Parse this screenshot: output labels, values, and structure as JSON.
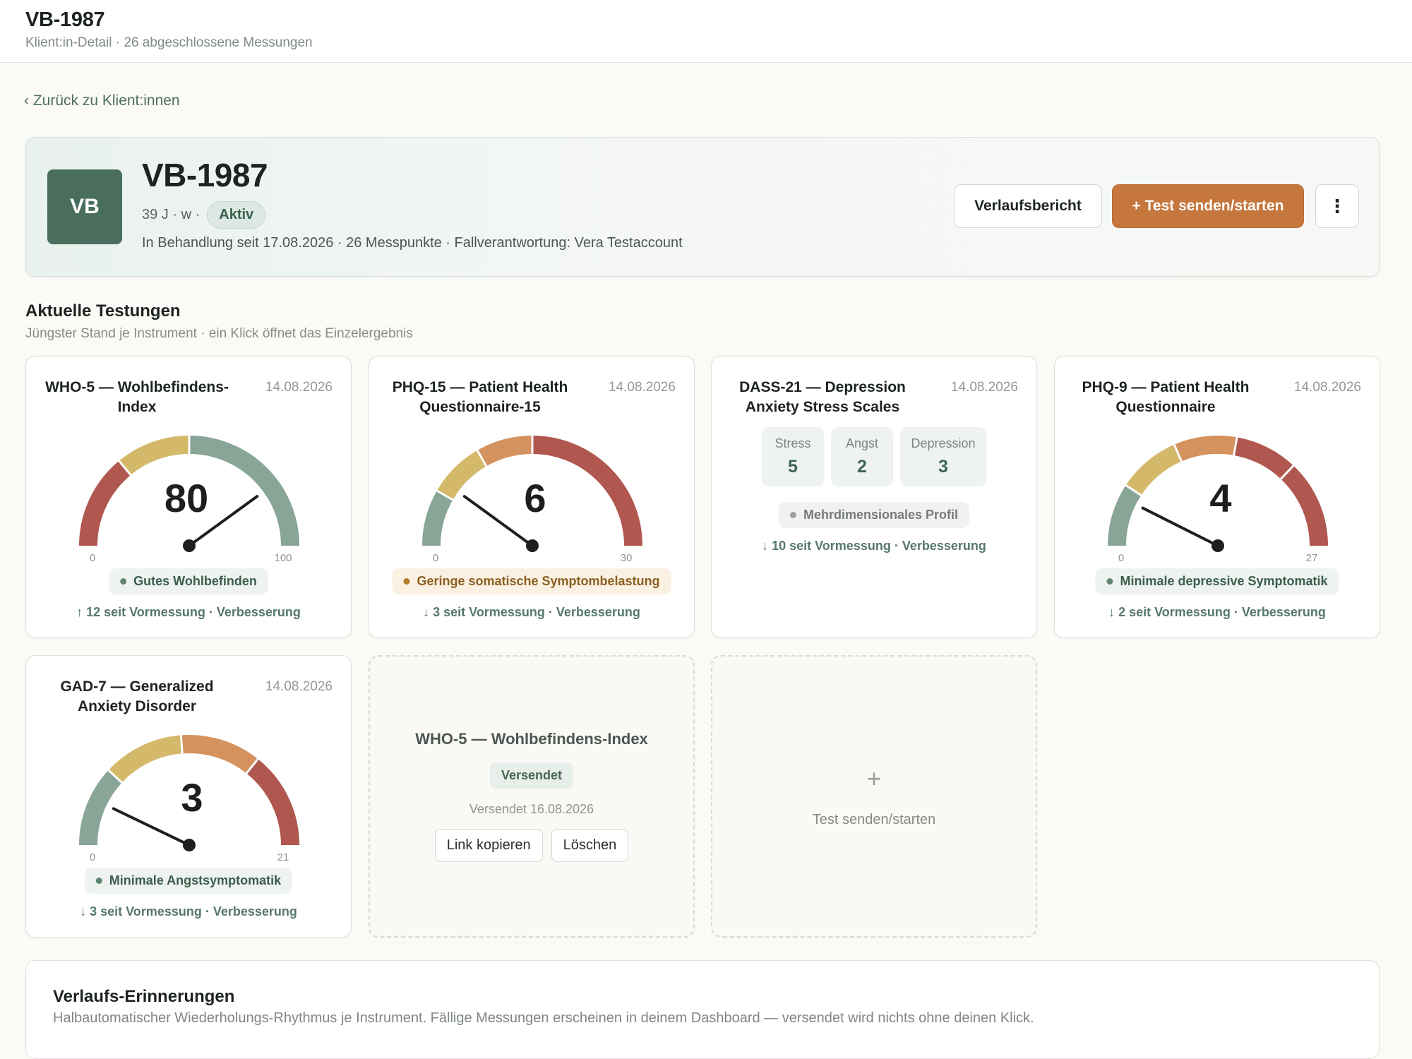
{
  "header": {
    "title": "VB-1987",
    "subtitle": "Klient:in-Detail · 26 abgeschlossene Messungen"
  },
  "back_link": "‹ Zurück zu Klient:innen",
  "client": {
    "initials": "VB",
    "name": "VB-1987",
    "meta": "39 J · w ·",
    "status": "Aktiv",
    "info": "In Behandlung seit 17.08.2026 · 26 Messpunkte · Fallverantwortung: Vera Testaccount"
  },
  "actions": {
    "report": "Verlaufsbericht",
    "send_test": "+ Test senden/starten",
    "more_icon": "more-vertical-icon",
    "more_glyph": "⋮"
  },
  "section": {
    "title": "Aktuelle Testungen",
    "subtitle": "Jüngster Stand je Instrument · ein Klick öffnet das Einzelergebnis"
  },
  "gauge_colors": {
    "green": "#88a597",
    "yellow": "#d4b96a",
    "orange": "#d4925e",
    "red": "#b0574f",
    "needle": "#1c1f1e"
  },
  "cards": [
    {
      "title": "WHO-5 — Wohlbefindens-Index",
      "date": "14.08.2026",
      "score": "80",
      "min": "0",
      "max": "100",
      "value": 80,
      "range_max": 100,
      "segments": [
        {
          "from": 0,
          "to": 28,
          "color": "red"
        },
        {
          "from": 28,
          "to": 50,
          "color": "yellow"
        },
        {
          "from": 50,
          "to": 100,
          "color": "green"
        }
      ],
      "status": "Gutes Wohlbefinden",
      "status_tone": "green",
      "delta": "↑ 12 seit Vormessung · Verbesserung"
    },
    {
      "title": "PHQ-15 — Patient Health Questionnaire-15",
      "date": "14.08.2026",
      "score": "6",
      "min": "0",
      "max": "30",
      "value": 6,
      "range_max": 30,
      "segments": [
        {
          "from": 0,
          "to": 5,
          "color": "green"
        },
        {
          "from": 5,
          "to": 10,
          "color": "yellow"
        },
        {
          "from": 10,
          "to": 15,
          "color": "orange"
        },
        {
          "from": 15,
          "to": 30,
          "color": "red"
        }
      ],
      "status": "Geringe somatische Symptombelastung",
      "status_tone": "yellow",
      "delta": "↓ 3 seit Vormessung · Verbesserung"
    },
    {
      "title": "DASS-21 — Depression Anxiety Stress Scales",
      "date": "14.08.2026",
      "subscales": [
        {
          "label": "Stress",
          "value": "5"
        },
        {
          "label": "Angst",
          "value": "2"
        },
        {
          "label": "Depression",
          "value": "3"
        }
      ],
      "status": "Mehrdimensionales Profil",
      "status_tone": "gray",
      "delta": "↓ 10 seit Vormessung · Verbesserung"
    },
    {
      "title": "PHQ-9 — Patient Health Questionnaire",
      "date": "14.08.2026",
      "score": "4",
      "min": "0",
      "max": "27",
      "value": 4,
      "range_max": 27,
      "segments": [
        {
          "from": 0,
          "to": 5,
          "color": "green"
        },
        {
          "from": 5,
          "to": 10,
          "color": "yellow"
        },
        {
          "from": 10,
          "to": 15,
          "color": "orange"
        },
        {
          "from": 15,
          "to": 20,
          "color": "red"
        },
        {
          "from": 20,
          "to": 27,
          "color": "red"
        }
      ],
      "status": "Minimale depressive Symptomatik",
      "status_tone": "green",
      "delta": "↓ 2 seit Vormessung · Verbesserung"
    },
    {
      "title": "GAD-7 — Generalized Anxiety Disorder",
      "date": "14.08.2026",
      "score": "3",
      "min": "0",
      "max": "21",
      "value": 3,
      "range_max": 21,
      "segments": [
        {
          "from": 0,
          "to": 5,
          "color": "green"
        },
        {
          "from": 5,
          "to": 10,
          "color": "yellow"
        },
        {
          "from": 10,
          "to": 15,
          "color": "orange"
        },
        {
          "from": 15,
          "to": 21,
          "color": "red"
        }
      ],
      "status": "Minimale Angstsymptomatik",
      "status_tone": "green",
      "delta": "↓ 3 seit Vormessung · Verbesserung"
    }
  ],
  "pending": {
    "title": "WHO-5 — Wohlbefindens-Index",
    "status": "Versendet",
    "date": "Versendet 16.08.2026",
    "copy_link": "Link kopieren",
    "delete": "Löschen"
  },
  "add_card": {
    "glyph": "+",
    "label": "Test senden/starten"
  },
  "reminders": {
    "title": "Verlaufs-Erinnerungen",
    "subtitle": "Halbautomatischer Wiederholungs-Rhythmus je Instrument. Fällige Messungen erscheinen in deinem Dashboard — versendet wird nichts ohne deinen Klick."
  }
}
